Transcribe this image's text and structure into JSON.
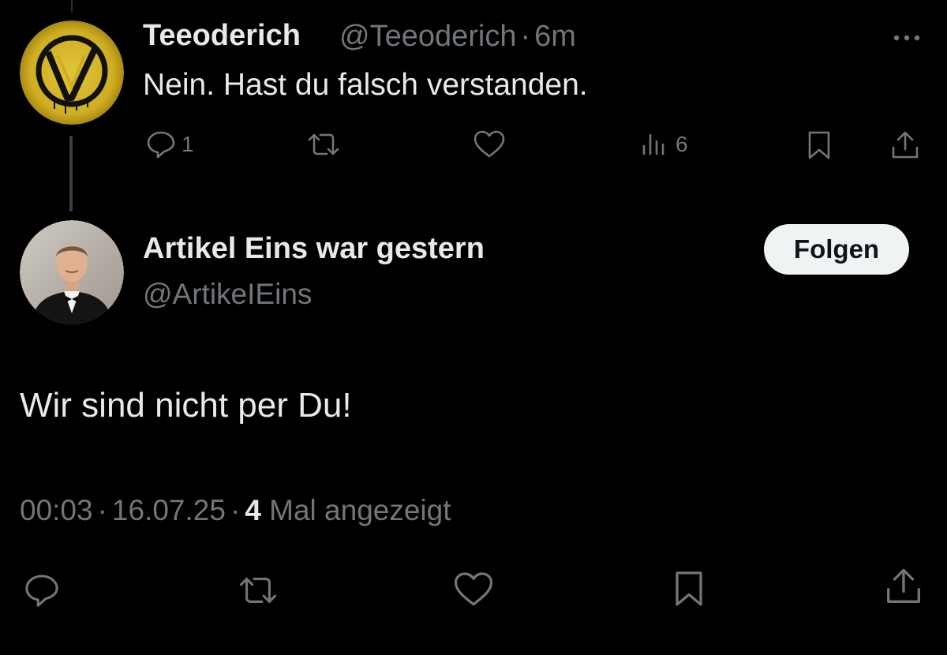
{
  "reply_tweet": {
    "display_name": "Teeoderich",
    "handle": "@Teeoderich",
    "separator": "·",
    "time_ago": "6m",
    "text": "Nein. Hast du falsch verstanden.",
    "reply_count": "1",
    "view_count": "6",
    "avatar_icon": "v-vendetta-logo-icon",
    "avatar_color": "#d6b62a"
  },
  "main_tweet": {
    "display_name": "Artikel Eins war gestern",
    "handle": "@ArtikeIEins",
    "follow_label": "Folgen",
    "text": "Wir sind nicht per Du!",
    "time": "00:03",
    "date": "16.07.25",
    "separator": "·",
    "views_number": "4",
    "views_label": "Mal angezeigt"
  },
  "colors": {
    "background": "#000000",
    "text_primary": "#e7e9ea",
    "text_secondary": "#71767b",
    "follow_button_bg": "#eff3f4"
  }
}
